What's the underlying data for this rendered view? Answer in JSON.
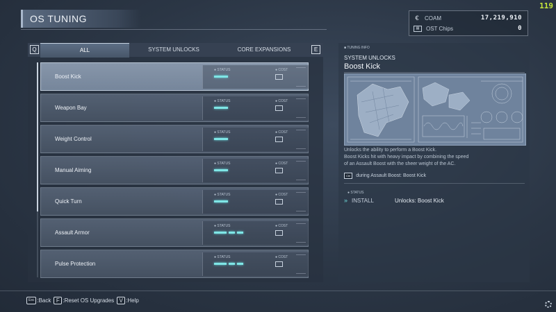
{
  "hud": {
    "fps": "119"
  },
  "header": {
    "title": "OS TUNING"
  },
  "currency": {
    "coam_label": "COAM",
    "coam_value": "17,219,910",
    "coam_icon": "currency-icon",
    "chips_label": "OST Chips",
    "chips_value": "0",
    "chips_icon": "chip-icon"
  },
  "tabs": {
    "prev_key": "Q",
    "next_key": "E",
    "items": [
      {
        "label": "ALL"
      },
      {
        "label": "SYSTEM UNLOCKS"
      },
      {
        "label": "CORE EXPANSIONS"
      }
    ],
    "active_index": 0
  },
  "list": {
    "status_label": "STATUS",
    "cost_label": "COST",
    "items": [
      {
        "name": "Boost Kick",
        "status_bars": 1
      },
      {
        "name": "Weapon Bay",
        "status_bars": 1
      },
      {
        "name": "Weight Control",
        "status_bars": 1
      },
      {
        "name": "Manual Aiming",
        "status_bars": 1
      },
      {
        "name": "Quick Turn",
        "status_bars": 1
      },
      {
        "name": "Assault Armor",
        "status_bars": 3
      },
      {
        "name": "Pulse Protection",
        "status_bars": 3
      }
    ],
    "selected_index": 0
  },
  "info": {
    "header": "TUNING INFO",
    "category": "SYSTEM UNLOCKS",
    "title": "Boost Kick",
    "description_lines": [
      "Unlocks the ability to perform a Boost Kick.",
      "Boost Kicks hit with heavy impact by combining the speed",
      "of an Assault Boost with the sheer weight of the AC."
    ],
    "control_key": "Ctrl",
    "control_text": "during Assault Boost: Boost Kick",
    "status_label": "STATUS",
    "install_label": "INSTALL",
    "unlocks_text": "Unlocks: Boost Kick"
  },
  "footer": {
    "back_key": "Esc",
    "back_label": ":Back",
    "reset_key": "F",
    "reset_label": ":Reset OS Upgrades",
    "help_key": "V",
    "help_label": ":Help"
  },
  "colors": {
    "accent": "#7fe6e6",
    "fps": "#c8e83a",
    "selected_row": "#8796aa"
  }
}
